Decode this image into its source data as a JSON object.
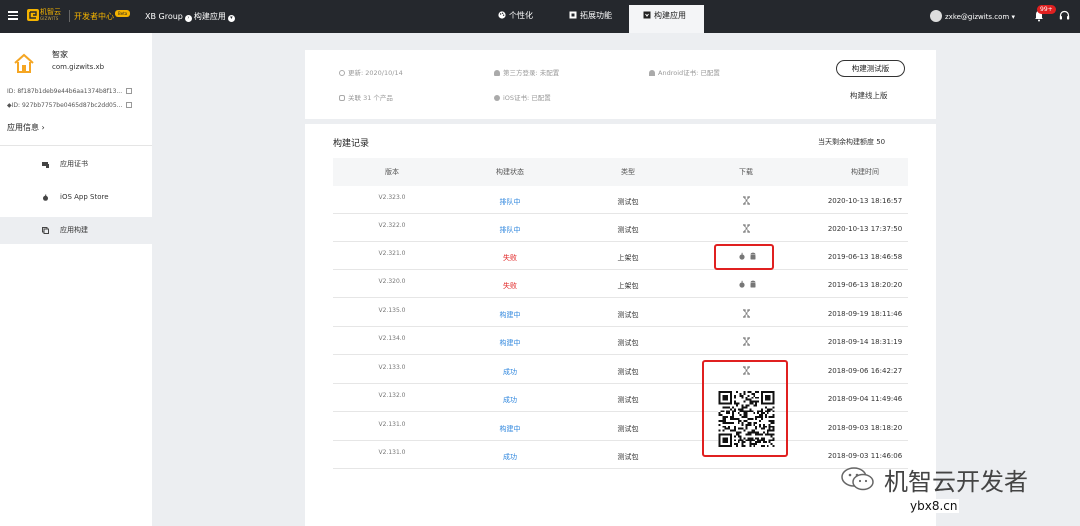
{
  "topbar": {
    "brand_cn": "机智云",
    "brand_en": "GIZWITS",
    "dev_center": "开发者中心",
    "beta": "Beta",
    "crumb_group": "XB Group",
    "crumb_page": "构建应用",
    "tabs": [
      {
        "label": "个性化",
        "icon": "palette-icon"
      },
      {
        "label": "拓展功能",
        "icon": "extension-icon"
      },
      {
        "label": "构建应用",
        "icon": "build-icon"
      }
    ],
    "user_email": "zxke@gizwits.com ▾",
    "badge_count": "99+"
  },
  "sidebar": {
    "app_name": "智家",
    "app_package": "com.gizwits.xb",
    "ios_id": "ID:  8f187b1deb9e44b6aa1374b8f13...",
    "android_id": "ID:  927bb7757be0465d87bc2dd05...",
    "app_info": "应用信息",
    "items": [
      {
        "label": "应用证书"
      },
      {
        "label": "iOS App Store"
      },
      {
        "label": "应用构建"
      }
    ]
  },
  "info": {
    "updated": "更新: 2020/10/14",
    "third_login": "第三方登录: 未配置",
    "android_cert": "Android证书: 已配置",
    "linked": "关联 31 个产品",
    "ios_cert": "iOS证书: 已配置",
    "btn_test": "构建测试版",
    "btn_online": "构建线上版"
  },
  "records": {
    "title": "构建记录",
    "quota": "当天剩余构建额度 50",
    "headers": [
      "版本",
      "构建状态",
      "类型",
      "下载",
      "构建时间"
    ],
    "rows": [
      {
        "version": "V2.323.0",
        "status": "排队中",
        "type": "测试包",
        "time": "2020-10-13 18:16:57"
      },
      {
        "version": "V2.322.0",
        "status": "排队中",
        "type": "测试包",
        "time": "2020-10-13 17:37:50"
      },
      {
        "version": "V2.321.0",
        "status": "失败",
        "type": "上架包",
        "time": "2019-06-13 18:46:58"
      },
      {
        "version": "V2.320.0",
        "status": "失败",
        "type": "上架包",
        "time": "2019-06-13 18:20:20"
      },
      {
        "version": "V2.135.0",
        "status": "构建中",
        "type": "测试包",
        "time": "2018-09-19 18:11:46"
      },
      {
        "version": "V2.134.0",
        "status": "构建中",
        "type": "测试包",
        "time": "2018-09-14 18:31:19"
      },
      {
        "version": "V2.133.0",
        "status": "成功",
        "type": "测试包",
        "time": "2018-09-06 16:42:27"
      },
      {
        "version": "V2.132.0",
        "status": "成功",
        "type": "测试包",
        "time": "2018-09-04 11:49:46"
      },
      {
        "version": "V2.131.0",
        "status": "构建中",
        "type": "测试包",
        "time": "2018-09-03 18:18:20"
      },
      {
        "version": "V2.131.0",
        "status": "成功",
        "type": "测试包",
        "time": "2018-09-03 11:46:06"
      }
    ]
  },
  "watermark": {
    "text": "机智云开发者",
    "url": "ybx8.cn"
  },
  "colors": {
    "topbar": "#25282d",
    "accent": "#f5b400",
    "link_blue": "#2e86de",
    "fail_red": "#e02020"
  }
}
